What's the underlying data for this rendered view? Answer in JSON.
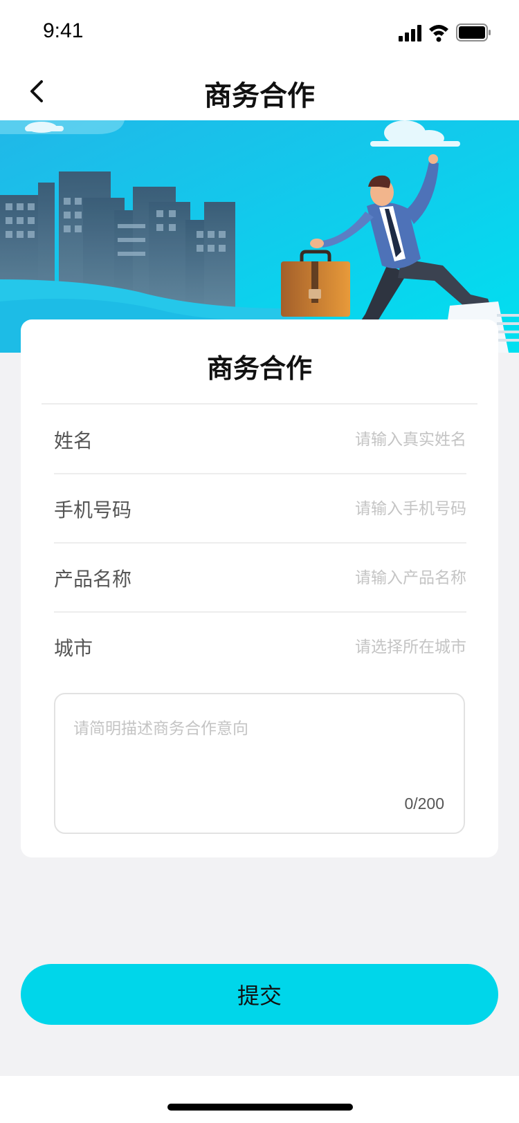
{
  "status_bar": {
    "time": "9:41",
    "icons": [
      "signal-icon",
      "wifi-icon",
      "battery-icon"
    ]
  },
  "nav": {
    "title": "商务合作",
    "back_icon": "chevron-left-icon"
  },
  "banner": {
    "illustration": "businessman-city-illustration"
  },
  "form": {
    "title": "商务合作",
    "fields": [
      {
        "label": "姓名",
        "placeholder": "请输入真实姓名"
      },
      {
        "label": "手机号码",
        "placeholder": "请输入手机号码"
      },
      {
        "label": "产品名称",
        "placeholder": "请输入产品名称"
      },
      {
        "label": "城市",
        "placeholder": "请选择所在城市"
      }
    ],
    "description": {
      "placeholder": "请简明描述商务合作意向",
      "count": "0/200"
    }
  },
  "submit": {
    "label": "提交"
  },
  "colors": {
    "accent": "#00d6ea",
    "page_bg": "#f2f2f4",
    "banner_sky": "#1ec9ef"
  }
}
